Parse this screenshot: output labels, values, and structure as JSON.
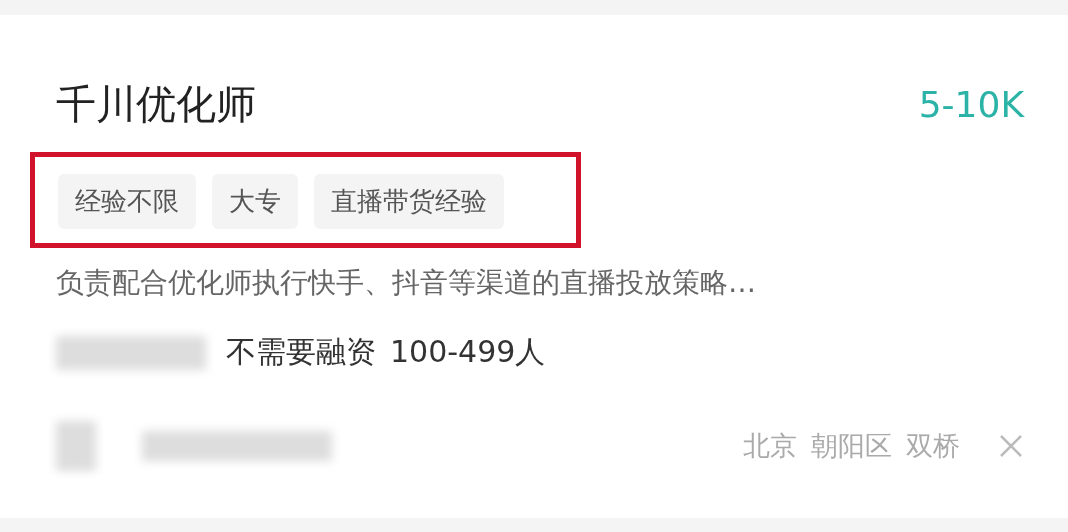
{
  "job": {
    "title": "千川优化师",
    "salary": "5-10K",
    "tags_highlighted": true,
    "tags": [
      "经验不限",
      "大专",
      "直播带货经验"
    ],
    "description": "负责配合优化师执行快手、抖音等渠道的直播投放策略…",
    "company_info": [
      "不需要融资",
      "100-499人"
    ],
    "location": [
      "北京",
      "朝阳区",
      "双桥"
    ]
  }
}
